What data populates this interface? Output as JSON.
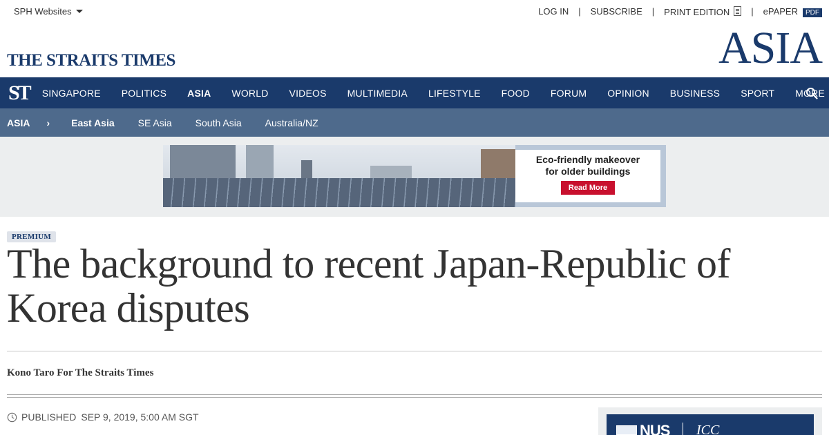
{
  "utility": {
    "sph_label": "SPH Websites",
    "login": "LOG IN",
    "subscribe": "SUBSCRIBE",
    "print_edition": "PRINT EDITION",
    "epaper": "ePAPER",
    "pdf": "PDF",
    "separator": "|"
  },
  "masthead": {
    "logo": "THE STRAITS TIMES",
    "section": "ASIA"
  },
  "nav": {
    "st_mark": "ST",
    "items": [
      "SINGAPORE",
      "POLITICS",
      "ASIA",
      "WORLD",
      "VIDEOS",
      "MULTIMEDIA",
      "LIFESTYLE",
      "FOOD",
      "FORUM",
      "OPINION",
      "BUSINESS",
      "SPORT"
    ],
    "active": "ASIA",
    "more": "MORE"
  },
  "subnav": {
    "home": "ASIA",
    "chevron": "›",
    "items": [
      "East Asia",
      "SE Asia",
      "South Asia",
      "Australia/NZ"
    ],
    "active": "East Asia"
  },
  "ad": {
    "title_line1": "Eco-friendly makeover",
    "title_line2": "for older buildings",
    "button": "Read More"
  },
  "article": {
    "badge": "PREMIUM",
    "headline": "The background to recent Japan-Republic of Korea disputes",
    "byline": "Kono Taro For The Straits Times",
    "published_label": "PUBLISHED",
    "published_date": "SEP 9, 2019, 5:00 AM SGT"
  },
  "side_ad": {
    "brand": "NUS",
    "sub": "ICC"
  },
  "colors": {
    "brand_navy": "#1a3a6b",
    "subnav": "#4e6a8c",
    "ad_button": "#c8102e"
  },
  "icons": {
    "search": "search-icon",
    "clock": "clock-icon",
    "print": "document-icon"
  }
}
